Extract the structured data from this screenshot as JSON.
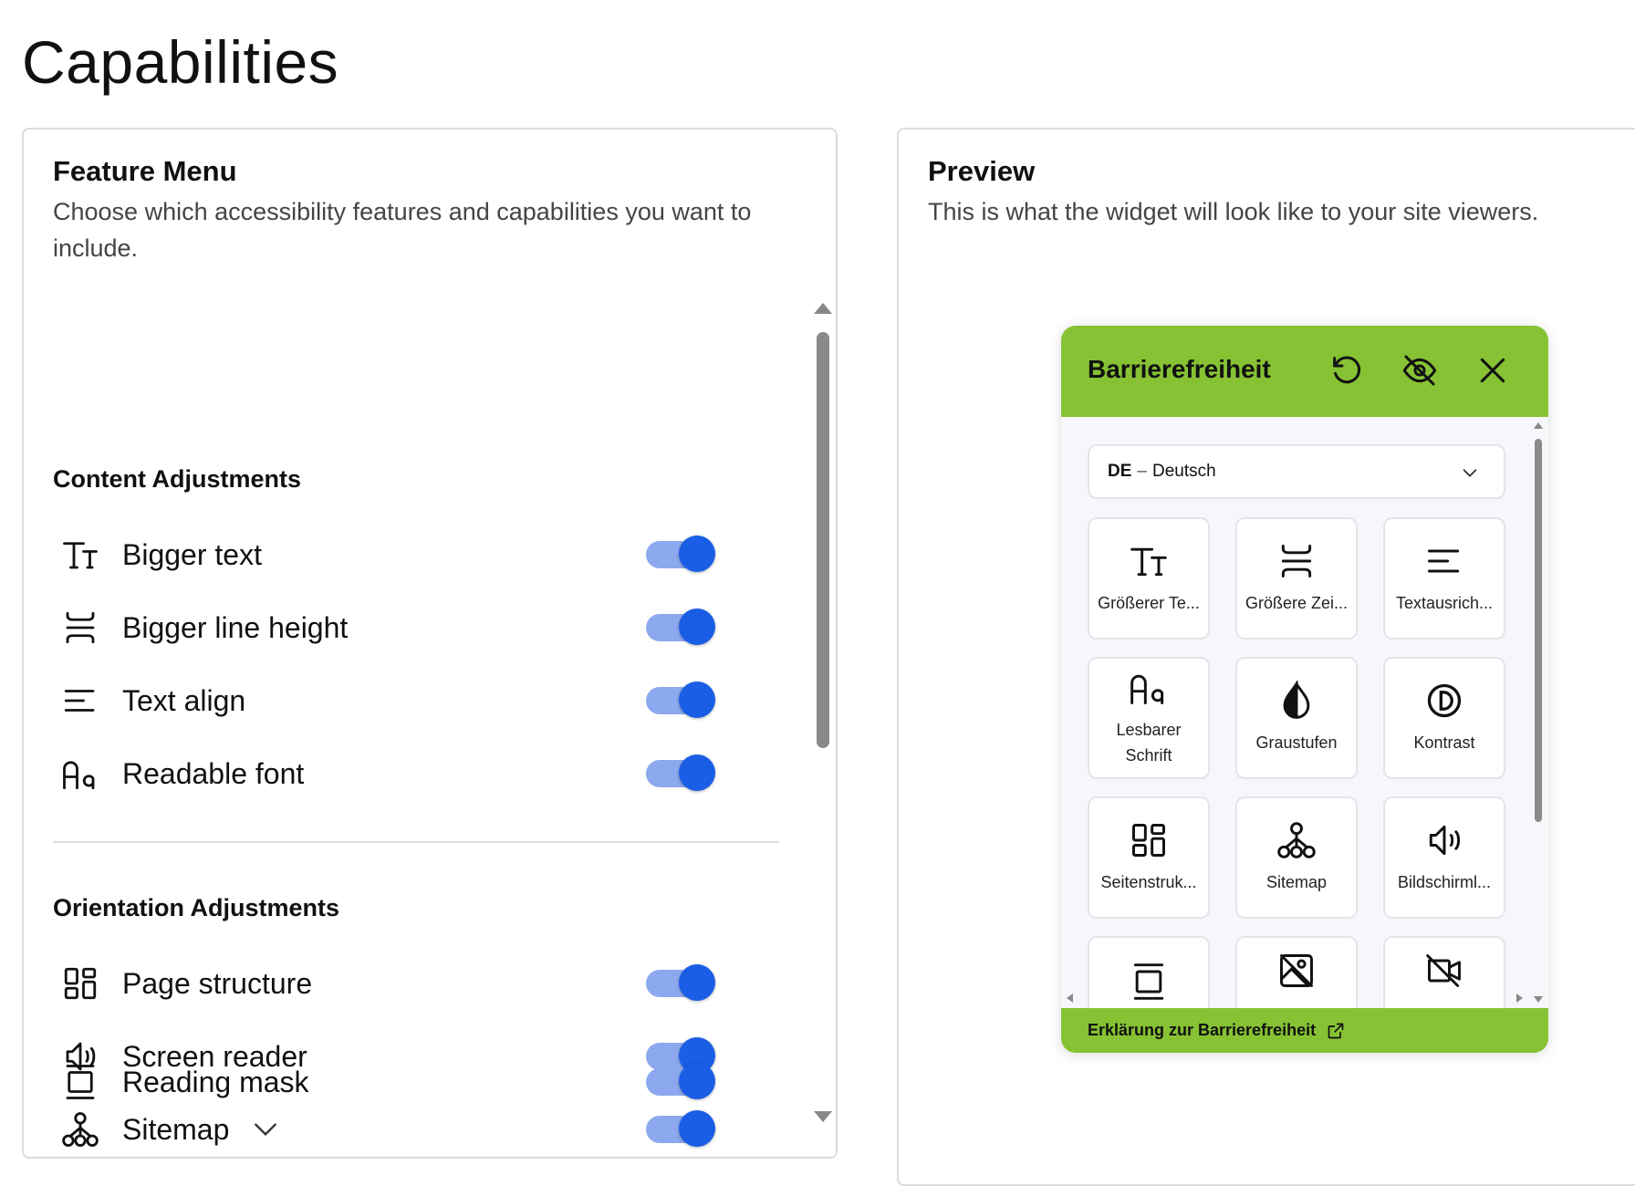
{
  "page": {
    "title": "Capabilities"
  },
  "feature_menu": {
    "title": "Feature Menu",
    "description": "Choose which accessibility features and capabilities you want to include.",
    "sections": [
      {
        "title": "Content Adjustments",
        "items": [
          {
            "label": "Bigger text",
            "icon": "bigger-text-icon",
            "enabled": true
          },
          {
            "label": "Bigger line height",
            "icon": "line-height-icon",
            "enabled": true
          },
          {
            "label": "Text align",
            "icon": "text-align-icon",
            "enabled": true
          },
          {
            "label": "Readable font",
            "icon": "readable-font-icon",
            "enabled": true
          }
        ]
      },
      {
        "title": "Orientation Adjustments",
        "items": [
          {
            "label": "Page structure",
            "icon": "page-structure-icon",
            "enabled": true
          },
          {
            "label": "Screen reader",
            "icon": "speaker-icon",
            "enabled": true
          },
          {
            "label": "Sitemap",
            "icon": "sitemap-icon",
            "enabled": true,
            "expandable": true
          },
          {
            "label": "Reading mask",
            "icon": "reading-mask-icon",
            "enabled": true
          }
        ]
      }
    ]
  },
  "preview": {
    "title": "Preview",
    "description": "This is what the widget will look like to your site viewers."
  },
  "widget": {
    "title": "Barrierefreiheit",
    "header_color": "#86c233",
    "language": {
      "code": "DE",
      "separator": "–",
      "name": "Deutsch"
    },
    "tiles": [
      {
        "label": "Größerer Te...",
        "icon": "bigger-text-icon"
      },
      {
        "label": "Größere Zei...",
        "icon": "line-height-icon"
      },
      {
        "label": "Textausrich...",
        "icon": "text-align-icon"
      },
      {
        "label": "Lesbarer Schrift",
        "icon": "readable-font-icon"
      },
      {
        "label": "Graustufen",
        "icon": "grayscale-drop-icon"
      },
      {
        "label": "Kontrast",
        "icon": "contrast-icon"
      },
      {
        "label": "Seitenstruk...",
        "icon": "page-structure-icon"
      },
      {
        "label": "Sitemap",
        "icon": "sitemap-icon"
      },
      {
        "label": "Bildschirml...",
        "icon": "speaker-icon"
      },
      {
        "label": "",
        "icon": "reading-mask-icon"
      },
      {
        "label": "",
        "icon": "hide-images-icon"
      },
      {
        "label": "",
        "icon": "video-off-icon"
      }
    ],
    "footer_label": "Erklärung zur Barrierefreiheit"
  },
  "colors": {
    "toggle_knob": "#1a5ee6",
    "toggle_track": "#8ca8ee",
    "accent_green": "#86c233"
  }
}
